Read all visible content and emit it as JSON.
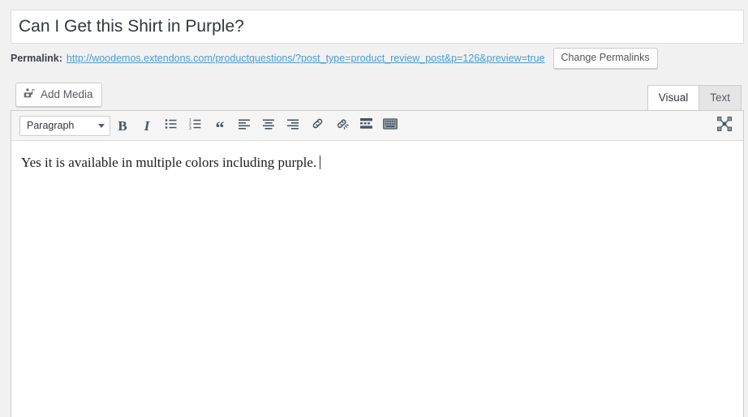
{
  "post": {
    "title": "Can I Get this Shirt in Purple?",
    "title_placeholder": "Enter title here"
  },
  "permalink": {
    "label": "Permalink:",
    "url": "http://woodemos.extendons.com/productquestions/?post_type=product_review_post&p=126&preview=true",
    "change_button": "Change Permalinks"
  },
  "media": {
    "add_media_label": "Add Media",
    "icon": "media-icon"
  },
  "editor_tabs": [
    {
      "label": "Visual",
      "active": true
    },
    {
      "label": "Text",
      "active": false
    }
  ],
  "toolbar": {
    "format_select": {
      "value": "Paragraph",
      "caret_icon": "chevron-down-icon"
    },
    "buttons": [
      {
        "name": "bold-button",
        "glyph": "B",
        "title": "Bold"
      },
      {
        "name": "italic-button",
        "glyph": "I",
        "title": "Italic"
      },
      {
        "name": "bulleted-list-button",
        "glyph": "bulleted-list-icon",
        "title": "Bulleted list"
      },
      {
        "name": "numbered-list-button",
        "glyph": "numbered-list-icon",
        "title": "Numbered list"
      },
      {
        "name": "blockquote-button",
        "glyph": "“",
        "title": "Blockquote"
      },
      {
        "name": "align-left-button",
        "glyph": "align-left-icon",
        "title": "Align left"
      },
      {
        "name": "align-center-button",
        "glyph": "align-center-icon",
        "title": "Align center"
      },
      {
        "name": "align-right-button",
        "glyph": "align-right-icon",
        "title": "Align right"
      },
      {
        "name": "insert-link-button",
        "glyph": "link-icon",
        "title": "Insert/edit link"
      },
      {
        "name": "remove-link-button",
        "glyph": "unlink-icon",
        "title": "Remove link"
      },
      {
        "name": "read-more-button",
        "glyph": "read-more-icon",
        "title": "Insert Read More tag"
      },
      {
        "name": "toolbar-toggle-button",
        "glyph": "toolbar-toggle-icon",
        "title": "Toolbar Toggle"
      }
    ],
    "fullscreen": {
      "name": "distraction-free-button",
      "title": "Distraction-free writing mode"
    }
  },
  "content": {
    "body_text": "Yes it is available in multiple colors including purple."
  },
  "colors": {
    "link": "#4b9cd3",
    "icon": "#46555f",
    "title_text": "#32373c",
    "toolbar_bg": "#f5f5f5",
    "page_bg": "#f1f1f1"
  }
}
